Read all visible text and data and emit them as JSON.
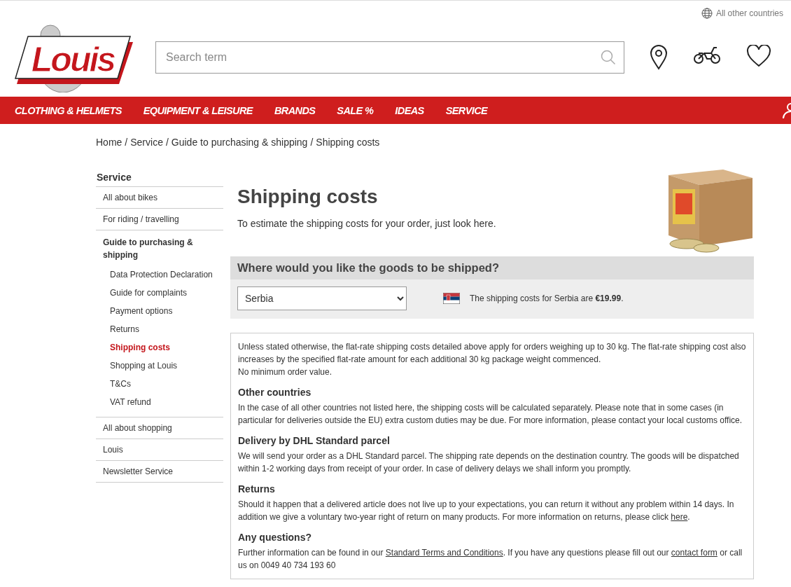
{
  "header": {
    "country_link": "All other countries",
    "logo": {
      "text": "Louis"
    },
    "search": {
      "placeholder": "Search term"
    }
  },
  "nav": {
    "items": [
      "CLOTHING & HELMETS",
      "EQUIPMENT & LEISURE",
      "BRANDS",
      "SALE %",
      "IDEAS",
      "SERVICE"
    ]
  },
  "breadcrumb": {
    "separator": "/",
    "items": [
      "Home",
      "Service",
      "Guide to purchasing & shipping",
      "Shipping costs"
    ]
  },
  "sidebar": {
    "title": "Service",
    "items": [
      {
        "label": "All about bikes",
        "expanded": false
      },
      {
        "label": "For riding / travelling",
        "expanded": false
      },
      {
        "label": "Guide to purchasing & shipping",
        "expanded": true,
        "children": [
          {
            "label": "Data Protection Declaration",
            "selected": false
          },
          {
            "label": "Guide for complaints",
            "selected": false
          },
          {
            "label": "Payment options",
            "selected": false
          },
          {
            "label": "Returns",
            "selected": false
          },
          {
            "label": "Shipping costs",
            "selected": true
          },
          {
            "label": "Shopping at Louis",
            "selected": false
          },
          {
            "label": "T&Cs",
            "selected": false
          },
          {
            "label": "VAT refund",
            "selected": false
          }
        ]
      },
      {
        "label": "All about shopping",
        "expanded": false
      },
      {
        "label": "Louis",
        "expanded": false
      },
      {
        "label": "Newsletter Service",
        "expanded": false
      }
    ]
  },
  "page": {
    "title": "Shipping costs",
    "intro": "To estimate the shipping costs for your order, just look here.",
    "shipping_panel": {
      "heading": "Where would you like the goods to be shipped?",
      "country_select": "Serbia",
      "result": "The shipping costs for Serbia are **€19.99**."
    },
    "sections": [
      {
        "paragraphs": [
          [
            {
              "kind": "text",
              "text": "Unless stated otherwise, the flat-rate shipping costs detailed above apply for orders weighing up to 30 kg. The flat-rate shipping cost also increases by the specified flat-rate amount for each additional 30 kg package weight commenced."
            }
          ],
          [
            {
              "kind": "text",
              "text": "No minimum order value."
            }
          ]
        ]
      },
      {
        "heading": "Other countries",
        "paragraphs": [
          [
            {
              "kind": "text",
              "text": "In the case of all other countries not listed here, the shipping costs will be calculated separately. Please note that in some cases (in particular for deliveries outside the EU) extra custom duties may be due. For more information, please contact your local customs office."
            }
          ]
        ]
      },
      {
        "heading": "Delivery by DHL Standard parcel",
        "paragraphs": [
          [
            {
              "kind": "text",
              "text": "We will send your order as a DHL Standard parcel. The shipping rate depends on the destination country. The goods will be dispatched within 1-2 working days from receipt of your order. In case of delivery delays we shall inform you promptly."
            }
          ]
        ]
      },
      {
        "heading": "Returns",
        "paragraphs": [
          [
            {
              "kind": "text",
              "text": "Should it happen that a delivered article does not live up to your expectations, you can return it without any problem within 14 days. In addition we give a voluntary two-year right of return on many products. For more information on returns, please click "
            },
            {
              "kind": "link",
              "text": "here"
            },
            {
              "kind": "text",
              "text": "."
            }
          ]
        ]
      },
      {
        "heading": "Any questions?",
        "paragraphs": [
          [
            {
              "kind": "text",
              "text": "Further information can be found in our "
            },
            {
              "kind": "link",
              "text": "Standard Terms and Conditions"
            },
            {
              "kind": "text",
              "text": ". If you have any questions please fill out our "
            },
            {
              "kind": "link",
              "text": "contact form"
            },
            {
              "kind": "text",
              "text": " or call us on 0049 40 734 193 60"
            }
          ]
        ]
      }
    ]
  }
}
